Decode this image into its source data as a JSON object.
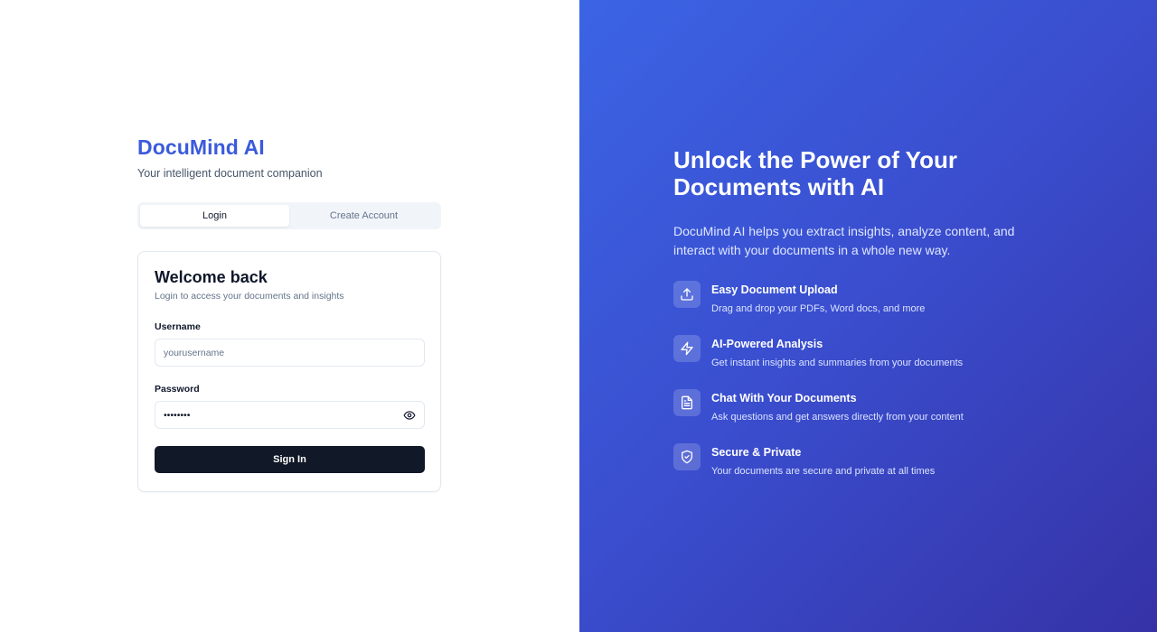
{
  "brand": {
    "title": "DocuMind AI",
    "tagline": "Your intelligent document companion",
    "color": "#3b5bdb"
  },
  "tabs": [
    {
      "label": "Login",
      "active": true
    },
    {
      "label": "Create Account",
      "active": false
    }
  ],
  "login": {
    "title": "Welcome back",
    "subtitle": "Login to access your documents and insights",
    "username_label": "Username",
    "username_placeholder": "yourusername",
    "username_value": "",
    "password_label": "Password",
    "password_value": "password",
    "submit_label": "Sign In"
  },
  "hero": {
    "title": "Unlock the Power of Your Documents with AI",
    "description": "DocuMind AI helps you extract insights, analyze content, and interact with your documents in a whole new way.",
    "features": [
      {
        "icon": "upload-icon",
        "title": "Easy Document Upload",
        "description": "Drag and drop your PDFs, Word docs, and more"
      },
      {
        "icon": "lightning-icon",
        "title": "AI-Powered Analysis",
        "description": "Get instant insights and summaries from your documents"
      },
      {
        "icon": "document-icon",
        "title": "Chat With Your Documents",
        "description": "Ask questions and get answers directly from your content"
      },
      {
        "icon": "shield-check-icon",
        "title": "Secure & Private",
        "description": "Your documents are secure and private at all times"
      }
    ]
  },
  "colors": {
    "accent": "#3b5bdb",
    "button": "#111827",
    "panel_gradient_start": "#3b64e4",
    "panel_gradient_end": "#3632a6"
  }
}
